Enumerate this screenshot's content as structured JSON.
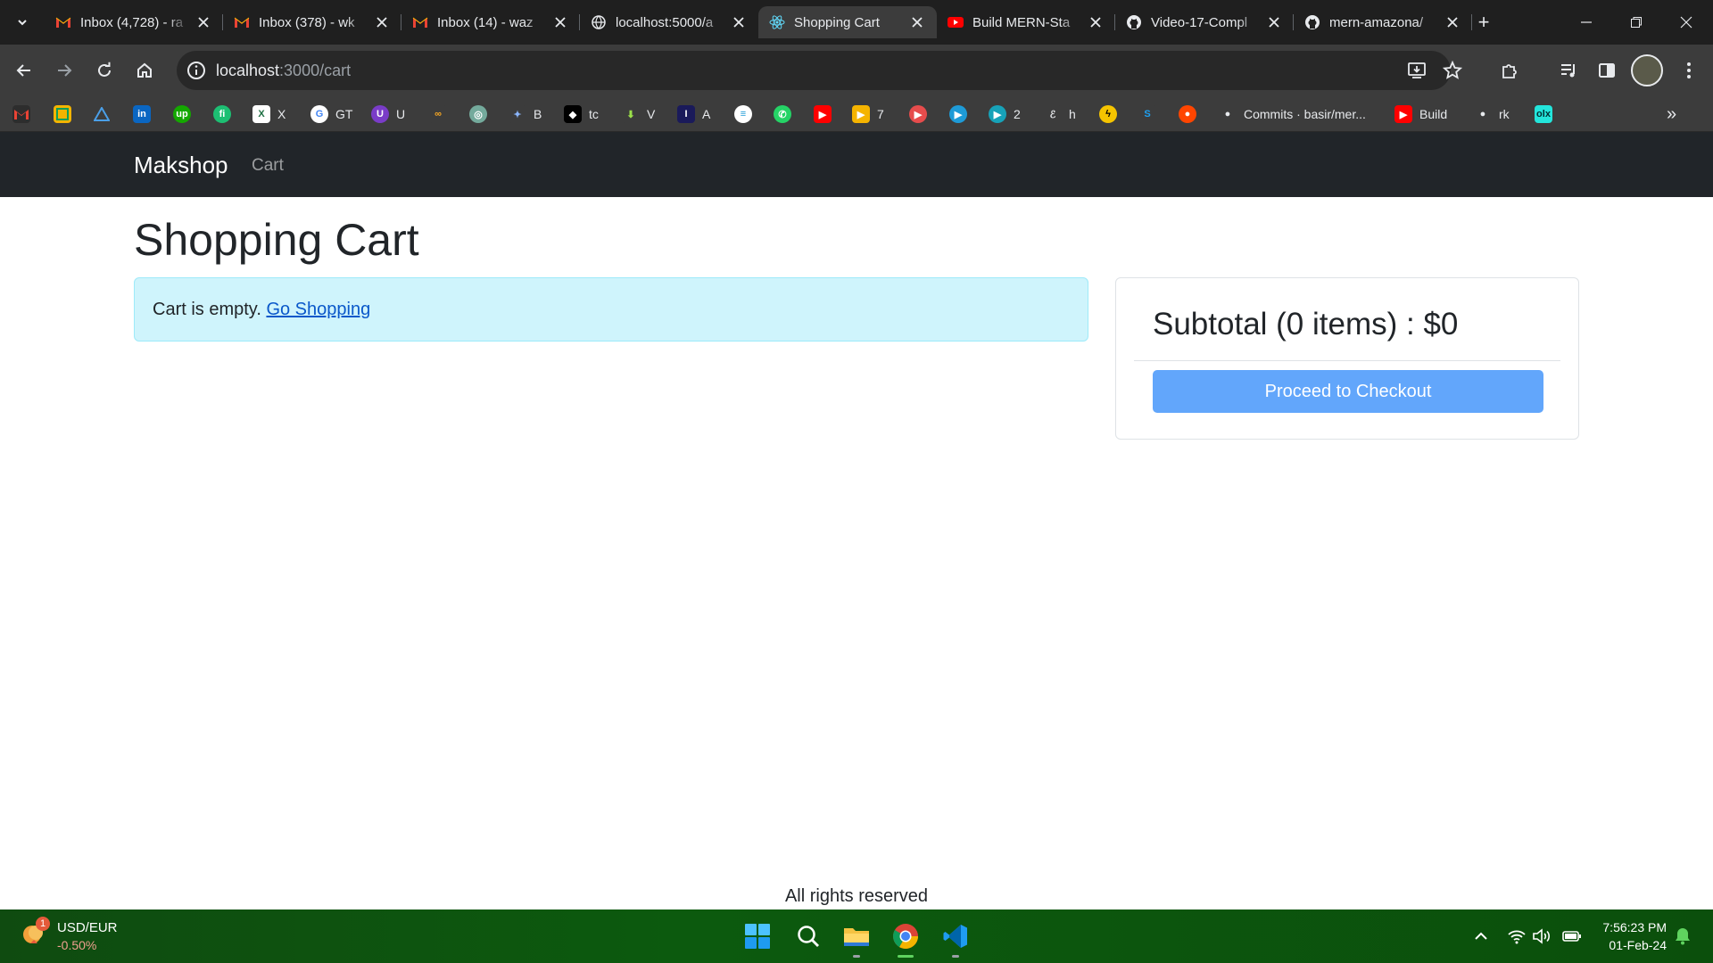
{
  "browser": {
    "tabs": [
      {
        "title": "Inbox (4,728) - ra",
        "icon": "gmail-icon"
      },
      {
        "title": "Inbox (378) - wk",
        "icon": "gmail-icon"
      },
      {
        "title": "Inbox (14) - waz",
        "icon": "gmail-icon"
      },
      {
        "title": "localhost:5000/a",
        "icon": "globe-icon"
      },
      {
        "title": "Shopping Cart",
        "icon": "react-icon",
        "active": true
      },
      {
        "title": "Build MERN-Sta",
        "icon": "youtube-icon"
      },
      {
        "title": "Video-17-Compl",
        "icon": "github-icon"
      },
      {
        "title": "mern-amazona/",
        "icon": "github-icon"
      }
    ],
    "new_tab": "+",
    "url_host": "localhost",
    "url_rest": ":3000/cart"
  },
  "bookmarks": [
    {
      "label": "",
      "icon": "gmail-icon"
    },
    {
      "label": "",
      "icon": "photos-icon"
    },
    {
      "label": "",
      "icon": "triangle-icon"
    },
    {
      "label": "",
      "icon": "linkedin-icon",
      "glyph": "in"
    },
    {
      "label": "",
      "icon": "upwork-icon",
      "glyph": "up"
    },
    {
      "label": "",
      "icon": "fiverr-icon",
      "glyph": "fi"
    },
    {
      "label": "X",
      "icon": "excel-icon",
      "glyph": "X"
    },
    {
      "label": "GT",
      "icon": "google-icon",
      "glyph": "G"
    },
    {
      "label": "U",
      "icon": "u-icon",
      "glyph": "U"
    },
    {
      "label": "",
      "icon": "infinity-icon",
      "glyph": "∞"
    },
    {
      "label": "",
      "icon": "chatgpt-icon",
      "glyph": "◎"
    },
    {
      "label": "B",
      "icon": "sparkle-icon",
      "glyph": "✦"
    },
    {
      "label": "tc",
      "icon": "diamond-icon",
      "glyph": "◆"
    },
    {
      "label": "V",
      "icon": "download-arrow-icon",
      "glyph": "⬇"
    },
    {
      "label": "A",
      "icon": "italic-icon",
      "glyph": "I"
    },
    {
      "label": "",
      "icon": "lines-icon",
      "glyph": "≡"
    },
    {
      "label": "",
      "icon": "whatsapp-icon",
      "glyph": "✆"
    },
    {
      "label": "",
      "icon": "youtube-icon",
      "glyph": "▶"
    },
    {
      "label": "7",
      "icon": "play-folder-icon",
      "glyph": "▶"
    },
    {
      "label": "",
      "icon": "play-red-icon",
      "glyph": "▶"
    },
    {
      "label": "",
      "icon": "play-blue-icon",
      "glyph": "▶"
    },
    {
      "label": "2",
      "icon": "play-cyan-icon",
      "glyph": "▶"
    },
    {
      "label": "h",
      "icon": "script-e-icon",
      "glyph": "ℰ"
    },
    {
      "label": "",
      "icon": "bolt-icon",
      "glyph": "ϟ"
    },
    {
      "label": "",
      "icon": "s-icon",
      "glyph": "S"
    },
    {
      "label": "",
      "icon": "reddit-icon",
      "glyph": "●"
    },
    {
      "label": "Commits · basir/mer...",
      "icon": "github-icon",
      "glyph": "●"
    },
    {
      "label": "Build",
      "icon": "youtube-icon",
      "glyph": "▶"
    },
    {
      "label": "rk",
      "icon": "github-icon",
      "glyph": "●"
    },
    {
      "label": "",
      "icon": "olx-icon",
      "glyph": "olx"
    }
  ],
  "bookmarks_overflow": "»",
  "navbar": {
    "brand": "Makshop",
    "cart_link": "Cart"
  },
  "main": {
    "title": "Shopping Cart",
    "empty_message": "Cart is empty.",
    "go_shopping": "Go Shopping",
    "subtotal": "Subtotal (0 items) : $0",
    "checkout_button": "Proceed to Checkout"
  },
  "footer": {
    "text": "All rights reserved"
  },
  "taskbar": {
    "ticker_name": "USD/EUR",
    "ticker_value": "-0.50%",
    "ticker_badge": "1",
    "time": "7:56:23 PM",
    "date": "01-Feb-24"
  },
  "colors": {
    "navbar_bg": "#212529",
    "alert_bg": "#cff4fc",
    "checkout_bg": "#62a6fb",
    "link": "#0a58ca"
  }
}
